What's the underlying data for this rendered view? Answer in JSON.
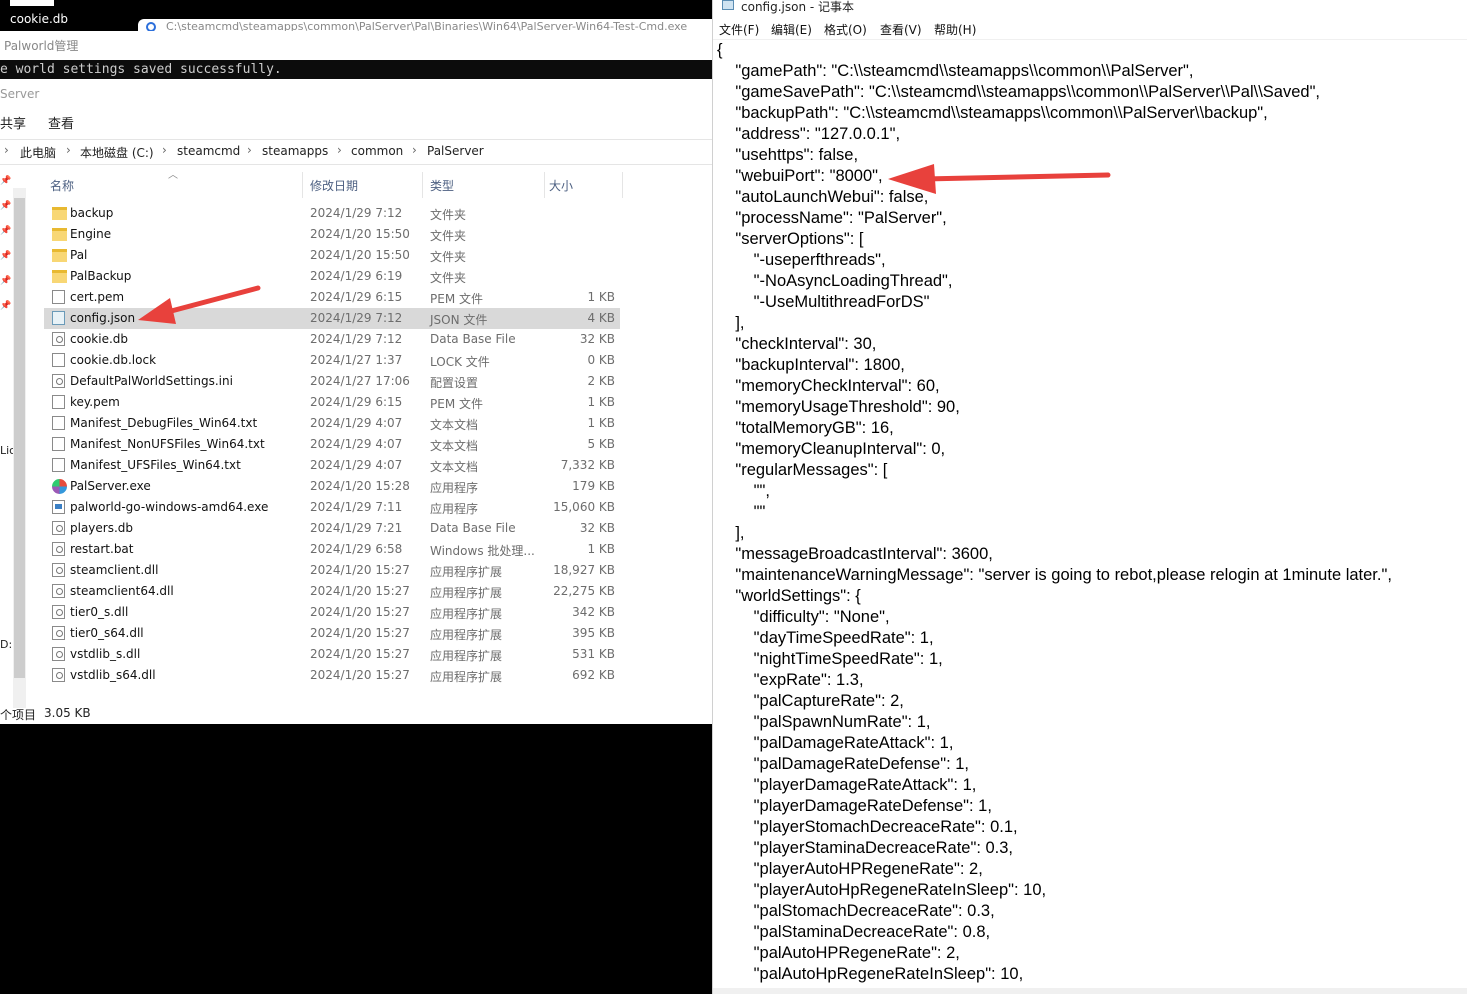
{
  "desktop": {
    "icon_label": "cookie.db"
  },
  "browser_tab": {
    "text": "C:\\steamcmd\\steamapps\\common\\PalServer\\Pal\\Binaries\\Win64\\PalServer-Win64-Test-Cmd.exe"
  },
  "console": {
    "title": "Palworld管理",
    "message": "e world settings saved successfully."
  },
  "explorer": {
    "title": "Server",
    "ribbon": [
      "共享",
      "查看"
    ],
    "breadcrumb": [
      "此电脑",
      "本地磁盘 (C:)",
      "steamcmd",
      "steamapps",
      "common",
      "PalServer"
    ],
    "columns": {
      "name": "名称",
      "date": "修改日期",
      "type": "类型",
      "size": "大小"
    },
    "files": [
      {
        "name": "backup",
        "date": "2024/1/29 7:12",
        "type": "文件夹",
        "size": "",
        "icon": "folder"
      },
      {
        "name": "Engine",
        "date": "2024/1/20 15:50",
        "type": "文件夹",
        "size": "",
        "icon": "folder"
      },
      {
        "name": "Pal",
        "date": "2024/1/20 15:50",
        "type": "文件夹",
        "size": "",
        "icon": "folder"
      },
      {
        "name": "PalBackup",
        "date": "2024/1/29 6:19",
        "type": "文件夹",
        "size": "",
        "icon": "folder"
      },
      {
        "name": "cert.pem",
        "date": "2024/1/29 6:15",
        "type": "PEM 文件",
        "size": "1 KB",
        "icon": "file"
      },
      {
        "name": "config.json",
        "date": "2024/1/29 7:12",
        "type": "JSON 文件",
        "size": "4 KB",
        "icon": "json",
        "selected": true
      },
      {
        "name": "cookie.db",
        "date": "2024/1/29 7:12",
        "type": "Data Base File",
        "size": "32 KB",
        "icon": "gear"
      },
      {
        "name": "cookie.db.lock",
        "date": "2024/1/27 1:37",
        "type": "LOCK 文件",
        "size": "0 KB",
        "icon": "file"
      },
      {
        "name": "DefaultPalWorldSettings.ini",
        "date": "2024/1/27 17:06",
        "type": "配置设置",
        "size": "2 KB",
        "icon": "gear"
      },
      {
        "name": "key.pem",
        "date": "2024/1/29 6:15",
        "type": "PEM 文件",
        "size": "1 KB",
        "icon": "file"
      },
      {
        "name": "Manifest_DebugFiles_Win64.txt",
        "date": "2024/1/29 4:07",
        "type": "文本文档",
        "size": "1 KB",
        "icon": "file"
      },
      {
        "name": "Manifest_NonUFSFiles_Win64.txt",
        "date": "2024/1/29 4:07",
        "type": "文本文档",
        "size": "5 KB",
        "icon": "file"
      },
      {
        "name": "Manifest_UFSFiles_Win64.txt",
        "date": "2024/1/29 4:07",
        "type": "文本文档",
        "size": "7,332 KB",
        "icon": "file"
      },
      {
        "name": "PalServer.exe",
        "date": "2024/1/20 15:28",
        "type": "应用程序",
        "size": "179 KB",
        "icon": "globe"
      },
      {
        "name": "palworld-go-windows-amd64.exe",
        "date": "2024/1/29 7:11",
        "type": "应用程序",
        "size": "15,060 KB",
        "icon": "exe"
      },
      {
        "name": "players.db",
        "date": "2024/1/29 7:21",
        "type": "Data Base File",
        "size": "32 KB",
        "icon": "gear"
      },
      {
        "name": "restart.bat",
        "date": "2024/1/29 6:58",
        "type": "Windows 批处理...",
        "size": "1 KB",
        "icon": "gear"
      },
      {
        "name": "steamclient.dll",
        "date": "2024/1/20 15:27",
        "type": "应用程序扩展",
        "size": "18,927 KB",
        "icon": "gear"
      },
      {
        "name": "steamclient64.dll",
        "date": "2024/1/20 15:27",
        "type": "应用程序扩展",
        "size": "22,275 KB",
        "icon": "gear"
      },
      {
        "name": "tier0_s.dll",
        "date": "2024/1/20 15:27",
        "type": "应用程序扩展",
        "size": "342 KB",
        "icon": "gear"
      },
      {
        "name": "tier0_s64.dll",
        "date": "2024/1/20 15:27",
        "type": "应用程序扩展",
        "size": "395 KB",
        "icon": "gear"
      },
      {
        "name": "vstdlib_s.dll",
        "date": "2024/1/20 15:27",
        "type": "应用程序扩展",
        "size": "531 KB",
        "icon": "gear"
      },
      {
        "name": "vstdlib_s64.dll",
        "date": "2024/1/20 15:27",
        "type": "应用程序扩展",
        "size": "692 KB",
        "icon": "gear"
      }
    ],
    "status": {
      "items": "个项目",
      "selected_size": "3.05 KB"
    },
    "edge_labels": [
      "Lic",
      "D:"
    ]
  },
  "notepad": {
    "title": "config.json - 记事本",
    "menus": [
      "文件(F)",
      "编辑(E)",
      "格式(O)",
      "查看(V)",
      "帮助(H)"
    ],
    "lines": [
      "{",
      "    \"gamePath\": \"C:\\\\steamcmd\\\\steamapps\\\\common\\\\PalServer\",",
      "    \"gameSavePath\": \"C:\\\\steamcmd\\\\steamapps\\\\common\\\\PalServer\\\\Pal\\\\Saved\",",
      "    \"backupPath\": \"C:\\\\steamcmd\\\\steamapps\\\\common\\\\PalServer\\\\backup\",",
      "    \"address\": \"127.0.0.1\",",
      "    \"usehttps\": false,",
      "    \"webuiPort\": \"8000\",",
      "    \"autoLaunchWebui\": false,",
      "    \"processName\": \"PalServer\",",
      "    \"serverOptions\": [",
      "        \"-useperfthreads\",",
      "        \"-NoAsyncLoadingThread\",",
      "        \"-UseMultithreadForDS\"",
      "    ],",
      "    \"checkInterval\": 30,",
      "    \"backupInterval\": 1800,",
      "    \"memoryCheckInterval\": 60,",
      "    \"memoryUsageThreshold\": 90,",
      "    \"totalMemoryGB\": 16,",
      "    \"memoryCleanupInterval\": 0,",
      "    \"regularMessages\": [",
      "        \"\",",
      "        \"\"",
      "    ],",
      "    \"messageBroadcastInterval\": 3600,",
      "    \"maintenanceWarningMessage\": \"server is going to rebot,please relogin at 1minute later.\",",
      "    \"worldSettings\": {",
      "        \"difficulty\": \"None\",",
      "        \"dayTimeSpeedRate\": 1,",
      "        \"nightTimeSpeedRate\": 1,",
      "        \"expRate\": 1.3,",
      "        \"palCaptureRate\": 2,",
      "        \"palSpawnNumRate\": 1,",
      "        \"palDamageRateAttack\": 1,",
      "        \"palDamageRateDefense\": 1,",
      "        \"playerDamageRateAttack\": 1,",
      "        \"playerDamageRateDefense\": 1,",
      "        \"playerStomachDecreaceRate\": 0.1,",
      "        \"playerStaminaDecreaceRate\": 0.3,",
      "        \"playerAutoHPRegeneRate\": 2,",
      "        \"playerAutoHpRegeneRateInSleep\": 10,",
      "        \"palStomachDecreaceRate\": 0.3,",
      "        \"palStaminaDecreaceRate\": 0.8,",
      "        \"palAutoHPRegeneRate\": 2,",
      "        \"palAutoHpRegeneRateInSleep\": 10,"
    ]
  },
  "colors": {
    "annotation_arrow": "#e8413c",
    "selection": "#d9d9d9",
    "console_bg": "#0c0c0c"
  }
}
